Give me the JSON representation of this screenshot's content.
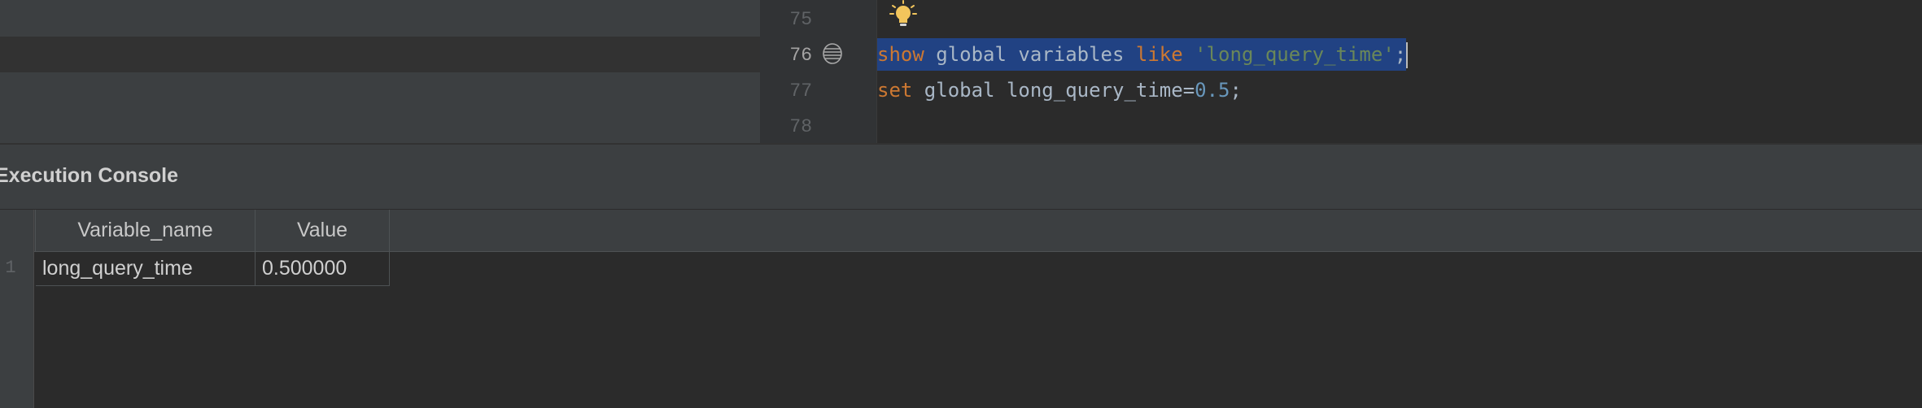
{
  "editor": {
    "line_numbers": [
      "75",
      "76",
      "77",
      "78"
    ],
    "line76": {
      "kw1": "show",
      "t1": " global variables ",
      "kw2": "like",
      "t2": " ",
      "str": "'long_query_time'",
      "t3": ";"
    },
    "line77": {
      "kw1": "set",
      "t1": " global long_query_time=",
      "num": "0.5",
      "t2": ";"
    }
  },
  "console": {
    "title": "Execution Console",
    "columns": [
      "Variable_name",
      "Value"
    ],
    "rows": [
      {
        "num": "1",
        "cells": [
          "long_query_time",
          "0.500000"
        ]
      }
    ]
  },
  "icons": {
    "bulb": "lightbulb-icon",
    "gutter_marker": "bookmark-list-icon"
  },
  "colors": {
    "keyword": "#cc7832",
    "string": "#6a8759",
    "number": "#6897bb",
    "selection": "#214283",
    "bulb": "#f2c55c"
  }
}
